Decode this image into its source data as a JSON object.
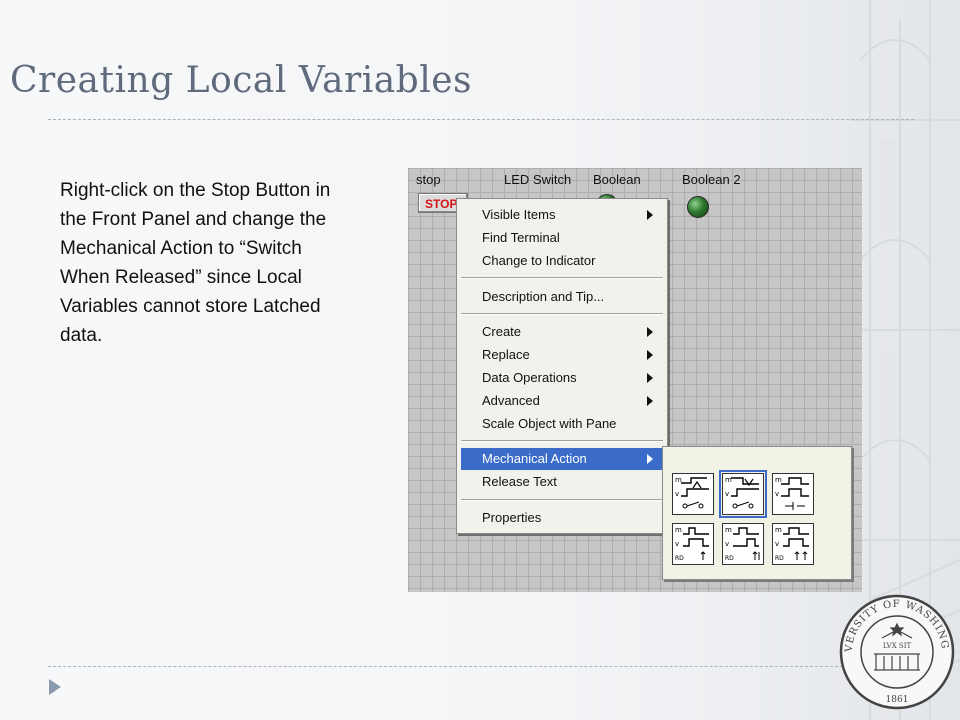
{
  "slide": {
    "title": "Creating Local Variables",
    "body": "Right-click on the Stop Button in the Front Panel and change the Mechanical Action to “Switch When Released” since Local Variables cannot store Latched data."
  },
  "front_panel": {
    "labels": {
      "stop": "stop",
      "led_switch": "LED Switch",
      "boolean": "Boolean",
      "boolean_2": "Boolean 2"
    },
    "stop_button_text": "STOP"
  },
  "context_menu": {
    "items": [
      {
        "label": "Visible Items",
        "has_submenu": true
      },
      {
        "label": "Find Terminal",
        "has_submenu": false
      },
      {
        "label": "Change to Indicator",
        "has_submenu": false
      },
      {
        "label": "Description and Tip...",
        "has_submenu": false
      },
      {
        "label": "Create",
        "has_submenu": true
      },
      {
        "label": "Replace",
        "has_submenu": true
      },
      {
        "label": "Data Operations",
        "has_submenu": true
      },
      {
        "label": "Advanced",
        "has_submenu": true
      },
      {
        "label": "Scale Object with Pane",
        "has_submenu": false
      },
      {
        "label": "Mechanical Action",
        "has_submenu": true,
        "highlighted": true
      },
      {
        "label": "Release Text",
        "has_submenu": false
      },
      {
        "label": "Properties",
        "has_submenu": false
      }
    ]
  },
  "mechanical_action_submenu": {
    "selected_index": 1,
    "icon_text": {
      "m": "m",
      "v": "v",
      "rd": "RD"
    }
  },
  "seal": {
    "text": "UNIVERSITY OF WASHINGTON",
    "motto": "LVX SIT",
    "year": "1861"
  },
  "colors": {
    "title": "#5f6b7c",
    "menu_highlight": "#3a6bc9",
    "stop_text": "#d21414",
    "seal": "#444444"
  }
}
